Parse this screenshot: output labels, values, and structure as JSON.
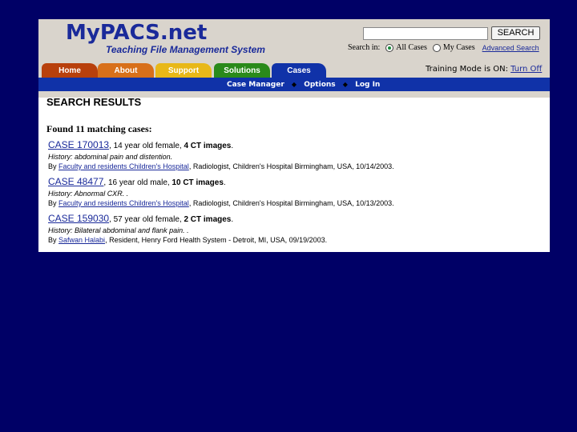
{
  "header": {
    "logo_title": "MyPACS.net",
    "logo_subtitle": "Teaching File Management System",
    "search_button": "SEARCH",
    "search_input_value": "",
    "search_in_label": "Search in:",
    "option_all_cases": "All Cases",
    "option_my_cases": "My Cases",
    "selected_option": "All Cases",
    "advanced_search": "Advanced Search"
  },
  "tabs": [
    {
      "label": "Home",
      "color": "#b8400c"
    },
    {
      "label": "About",
      "color": "#d8701a"
    },
    {
      "label": "Support",
      "color": "#e8b818"
    },
    {
      "label": "Solutions",
      "color": "#2a8a1a"
    },
    {
      "label": "Cases",
      "color": "#1032a8"
    }
  ],
  "active_tab": "Cases",
  "training": {
    "text": "Training Mode is ON:",
    "link": "Turn Off"
  },
  "subnav": [
    "Case Manager",
    "Options",
    "Log In"
  ],
  "results": {
    "title": "SEARCH RESULTS",
    "found": "Found 11 matching cases:",
    "cases": [
      {
        "id": "CASE 170013",
        "comma": ",",
        "desc_prefix": " 14 year old female, ",
        "images": "4 CT images",
        "desc_suffix": ".",
        "history": "History: abdominal pain and distention.",
        "by": "By ",
        "author": "Faculty and residents Children's Hospital",
        "details": ", Radiologist, Children's Hospital Birmingham, USA, 10/14/2003."
      },
      {
        "id": "CASE 48477",
        "comma": ",",
        "desc_prefix": " 16 year old male, ",
        "images": "10 CT images",
        "desc_suffix": ".",
        "history": "History: Abnormal CXR. .",
        "by": "By ",
        "author": "Faculty and residents Children's Hospital",
        "details": ", Radiologist, Children's Hospital Birmingham, USA, 10/13/2003."
      },
      {
        "id": "CASE 159030",
        "comma": ",",
        "desc_prefix": " 57 year old female, ",
        "images": "2 CT images",
        "desc_suffix": ".",
        "history": "History: Bilateral abdominal and flank pain. .",
        "by": "By ",
        "author": "Safwan Halabi",
        "details": ", Resident, Henry Ford Health System - Detroit, MI, USA, 09/19/2003."
      }
    ]
  },
  "colors": {
    "background": "#000066",
    "header_bg": "#d9d4cc",
    "brand_blue": "#1a2a9a",
    "subnav_bg": "#1032a8"
  }
}
